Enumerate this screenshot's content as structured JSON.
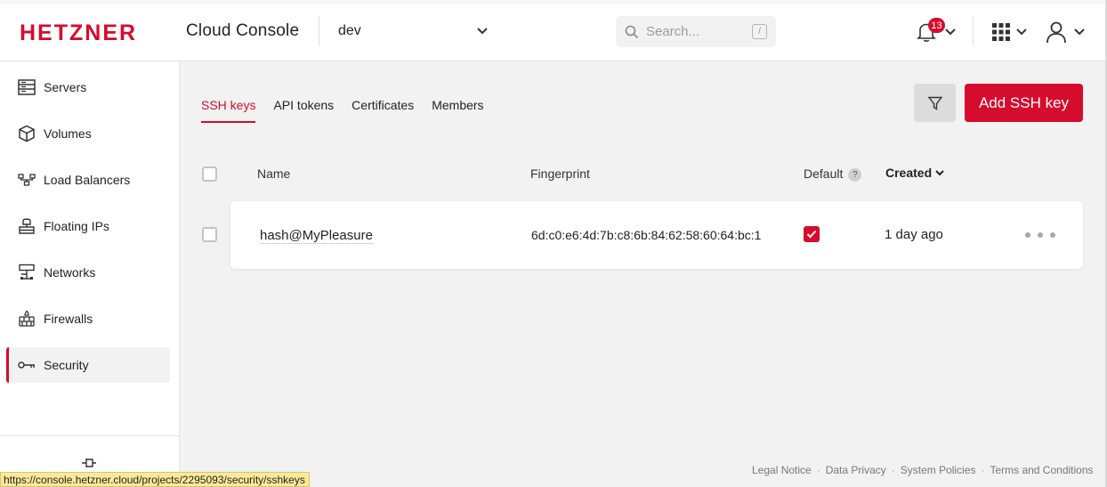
{
  "header": {
    "brand": "HETZNER",
    "app_title": "Cloud Console",
    "project": "dev",
    "search_placeholder": "Search...",
    "search_shortcut": "/",
    "notifications_count": "13",
    "accent_color": "#d50c2d"
  },
  "sidebar": {
    "items": [
      {
        "label": "Servers",
        "icon": "server-icon"
      },
      {
        "label": "Volumes",
        "icon": "cube-icon"
      },
      {
        "label": "Load Balancers",
        "icon": "load-balancer-icon"
      },
      {
        "label": "Floating IPs",
        "icon": "floating-ip-icon"
      },
      {
        "label": "Networks",
        "icon": "network-icon"
      },
      {
        "label": "Firewalls",
        "icon": "firewall-icon"
      },
      {
        "label": "Security",
        "icon": "key-icon",
        "active": true
      }
    ]
  },
  "main": {
    "tabs": [
      {
        "label": "SSH keys",
        "active": true
      },
      {
        "label": "API tokens"
      },
      {
        "label": "Certificates"
      },
      {
        "label": "Members"
      }
    ],
    "add_button": "Add SSH key",
    "columns": {
      "name": "Name",
      "fingerprint": "Fingerprint",
      "default": "Default",
      "default_help": "?",
      "created": "Created"
    },
    "rows": [
      {
        "name": "hash@MyPleasure",
        "fingerprint": "6d:c0:e6:4d:7b:c8:6b:84:62:58:60:64:bc:1",
        "default": true,
        "created": "1 day ago"
      }
    ]
  },
  "footer": {
    "links": [
      "Legal Notice",
      "Data Privacy",
      "System Policies",
      "Terms and Conditions"
    ]
  },
  "status_bar": {
    "url": "https://console.hetzner.cloud/projects/2295093/security/sshkeys"
  }
}
